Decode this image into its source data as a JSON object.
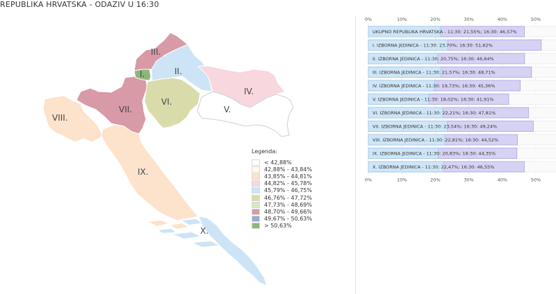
{
  "header": {
    "title": "REPUBLIKA HRVATSKA - ODAZIV U 16:30"
  },
  "map": {
    "regions": [
      {
        "label": "I.",
        "color": "#8db77a"
      },
      {
        "label": "II.",
        "color": "#cde4f7"
      },
      {
        "label": "III.",
        "color": "#d79aa6"
      },
      {
        "label": "IV.",
        "color": "#f8d7df"
      },
      {
        "label": "V.",
        "color": "#ffffff"
      },
      {
        "label": "VI.",
        "color": "#d9dcaa"
      },
      {
        "label": "VII.",
        "color": "#d79aa6"
      },
      {
        "label": "VIII.",
        "color": "#fde2cc"
      },
      {
        "label": "IX.",
        "color": "#fde2cc"
      },
      {
        "label": "X.",
        "color": "#cde4f7"
      }
    ]
  },
  "legend": {
    "title": "Legenda:",
    "items": [
      {
        "label": "< 42,88%",
        "color": "#ffffff"
      },
      {
        "label": "42,88% - 43,84%",
        "color": "#fffbe2"
      },
      {
        "label": "43,85% - 44,81%",
        "color": "#fde2cc"
      },
      {
        "label": "44,82% - 45,78%",
        "color": "#f8d7df"
      },
      {
        "label": "45,79% - 46,75%",
        "color": "#cde4f7"
      },
      {
        "label": "46,76% - 47,72%",
        "color": "#d9dcaa"
      },
      {
        "label": "47,73% - 48,69%",
        "color": "#d8e8c2"
      },
      {
        "label": "48,70% - 49,66%",
        "color": "#d79aa6"
      },
      {
        "label": "49,67% - 50,63%",
        "color": "#98aacf"
      },
      {
        "label": "> 50,63%",
        "color": "#8db77a"
      }
    ]
  },
  "chart_data": {
    "type": "bar",
    "orientation": "horizontal",
    "xlim": [
      0,
      55
    ],
    "ticks": [
      "0%",
      "10%",
      "20%",
      "30%",
      "40%",
      "50%"
    ],
    "tick_values": [
      0,
      10,
      20,
      30,
      40,
      50
    ],
    "colors": {
      "v1130": "#cfe6f8",
      "v1630": "#d6d2f4",
      "border1130": "#9ec8ea",
      "border1630": "#a9a2e6"
    },
    "categories": [
      "UKUPNO REPUBLIKA HRVATSKA - 11:30: 21,55%; 16:30: 46,57%",
      "I. IZBORNA JEDINICA - 11:30: 23,70%; 16:30: 51,62%",
      "II. IZBORNA JEDINICA - 11:30: 20,75%; 16:30: 46,64%",
      "III. IZBORNA JEDINICA - 11:30: 21,57%; 16:30: 48,71%",
      "IV. IZBORNA JEDINICA - 11:30: 19,73%; 16:30: 45,36%",
      "V. IZBORNA JEDINICA - 11:30: 18,02%; 16:30: 41,91%",
      "VI. IZBORNA JEDINICA - 11:30: 22,21%; 16:30: 47,81%",
      "VII. IZBORNA JEDINICA - 11:30: 23,54%; 16:30: 49,24%",
      "VIII. IZBORNA JEDINICA - 11:30: 22,81%; 16:30: 44,52%",
      "IX. IZBORNA JEDINICA - 11:30: 20,83%; 16:30: 44,35%",
      "X. IZBORNA JEDINICA - 11:30: 22,47%; 16:30: 46,55%"
    ],
    "series": [
      {
        "name": "11:30",
        "values": [
          21.55,
          23.7,
          20.75,
          21.57,
          19.73,
          18.02,
          22.21,
          23.54,
          22.81,
          20.83,
          22.47
        ]
      },
      {
        "name": "16:30",
        "values": [
          46.57,
          51.62,
          46.64,
          48.71,
          45.36,
          41.91,
          47.81,
          49.24,
          44.52,
          44.35,
          46.55
        ]
      }
    ]
  }
}
